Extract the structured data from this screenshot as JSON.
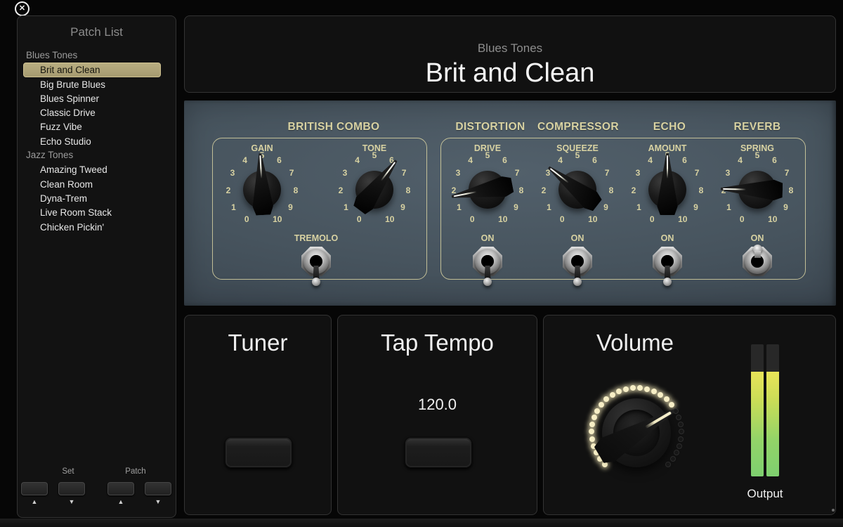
{
  "window": {
    "close_label": "✕"
  },
  "sidebar": {
    "title": "Patch List",
    "selected_patch": "Brit and Clean",
    "groups": [
      {
        "label": "Blues Tones",
        "patches": [
          "Brit and Clean",
          "Big Brute Blues",
          "Blues Spinner",
          "Classic Drive",
          "Fuzz Vibe",
          "Echo Studio"
        ]
      },
      {
        "label": "Jazz Tones",
        "patches": [
          "Amazing Tweed",
          "Clean Room",
          "Dyna-Trem",
          "Live Room Stack",
          "Chicken Pickin'"
        ]
      }
    ],
    "nav": {
      "set_label": "Set",
      "patch_label": "Patch",
      "up": "▲",
      "down": "▼"
    }
  },
  "header": {
    "set_name": "Blues Tones",
    "patch_name": "Brit and Clean"
  },
  "amp": {
    "panel_color": "#47545e",
    "label_color": "#d8d2a2",
    "scale": [
      "0",
      "1",
      "2",
      "3",
      "4",
      "5",
      "6",
      "7",
      "8",
      "9",
      "10"
    ],
    "sections": [
      {
        "title": "BRITISH COMBO",
        "knobs": [
          {
            "label": "GAIN",
            "value": 4.9
          },
          {
            "label": "TONE",
            "value": 6.2
          }
        ],
        "switch": {
          "label": "TREMOLO",
          "position": "down"
        }
      },
      {
        "title": "DISTORTION",
        "knobs": [
          {
            "label": "DRIVE",
            "value": 1.7
          }
        ],
        "switch": {
          "label": "ON",
          "position": "down"
        }
      },
      {
        "title": "COMPRESSOR",
        "knobs": [
          {
            "label": "SQUEEZE",
            "value": 3.3
          }
        ],
        "switch": {
          "label": "ON",
          "position": "down"
        }
      },
      {
        "title": "ECHO",
        "knobs": [
          {
            "label": "AMOUNT",
            "value": 5.0
          }
        ],
        "switch": {
          "label": "ON",
          "position": "down"
        }
      },
      {
        "title": "REVERB",
        "knobs": [
          {
            "label": "SPRING",
            "value": 2.1
          }
        ],
        "switch": {
          "label": "ON",
          "position": "up"
        }
      }
    ]
  },
  "tuner": {
    "title": "Tuner"
  },
  "tap_tempo": {
    "title": "Tap Tempo",
    "bpm": "120.0"
  },
  "volume": {
    "title": "Volume",
    "value_fraction": 0.72,
    "output_label": "Output",
    "meter": {
      "level_fraction": 0.79
    }
  }
}
